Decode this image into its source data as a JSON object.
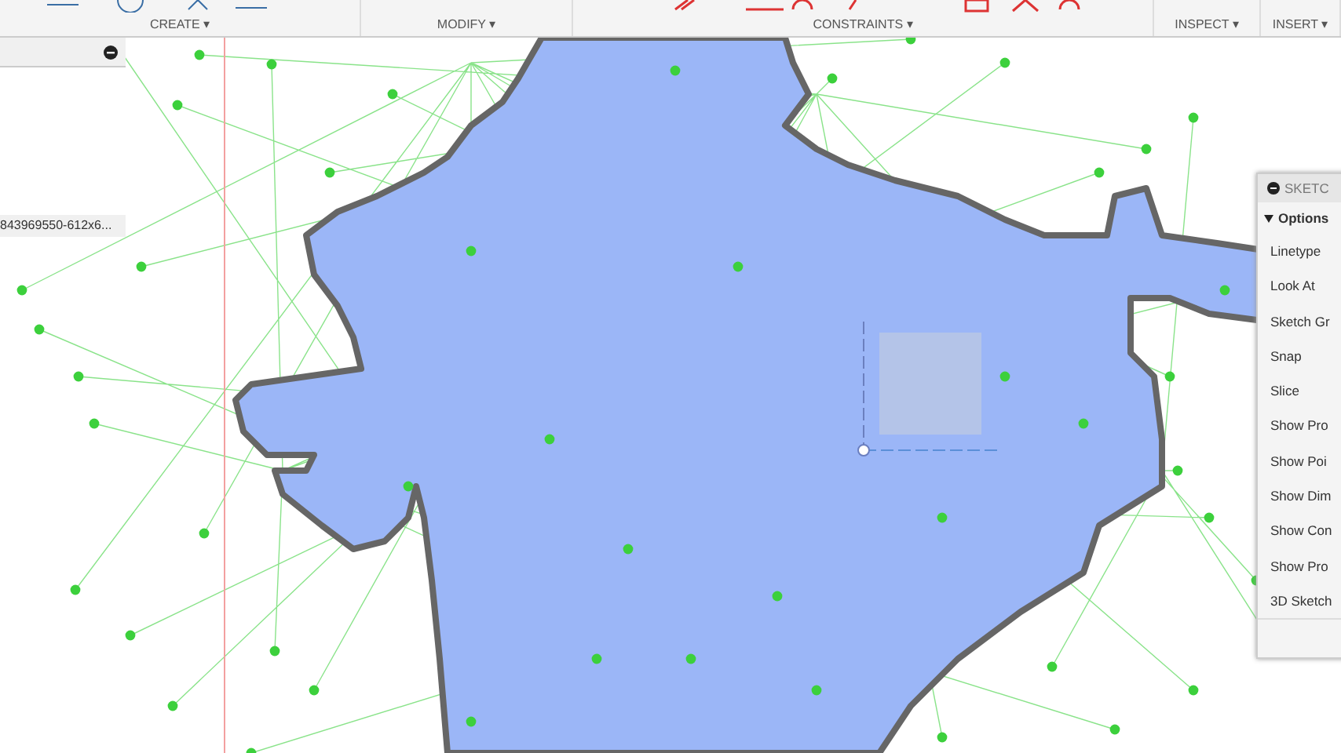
{
  "toolbar": {
    "groups": [
      {
        "label": "CREATE ▾"
      },
      {
        "label": "MODIFY ▾"
      },
      {
        "label": "CONSTRAINTS ▾"
      },
      {
        "label": "INSPECT ▾"
      },
      {
        "label": "INSERT ▾"
      }
    ]
  },
  "browser": {
    "canvas_label": "843969550-612x6..."
  },
  "palette": {
    "title": "SKETC",
    "section": {
      "label": "Options",
      "expanded": true
    },
    "options": [
      {
        "label": "Linetype"
      },
      {
        "label": "Look At"
      },
      {
        "label": "Sketch Gr"
      },
      {
        "label": "Snap"
      },
      {
        "label": "Slice"
      },
      {
        "label": "Show Pro"
      },
      {
        "label": "Show Poi"
      },
      {
        "label": "Show Dim"
      },
      {
        "label": "Show Con"
      },
      {
        "label": "Show Pro"
      },
      {
        "label": "3D Sketch"
      }
    ]
  }
}
